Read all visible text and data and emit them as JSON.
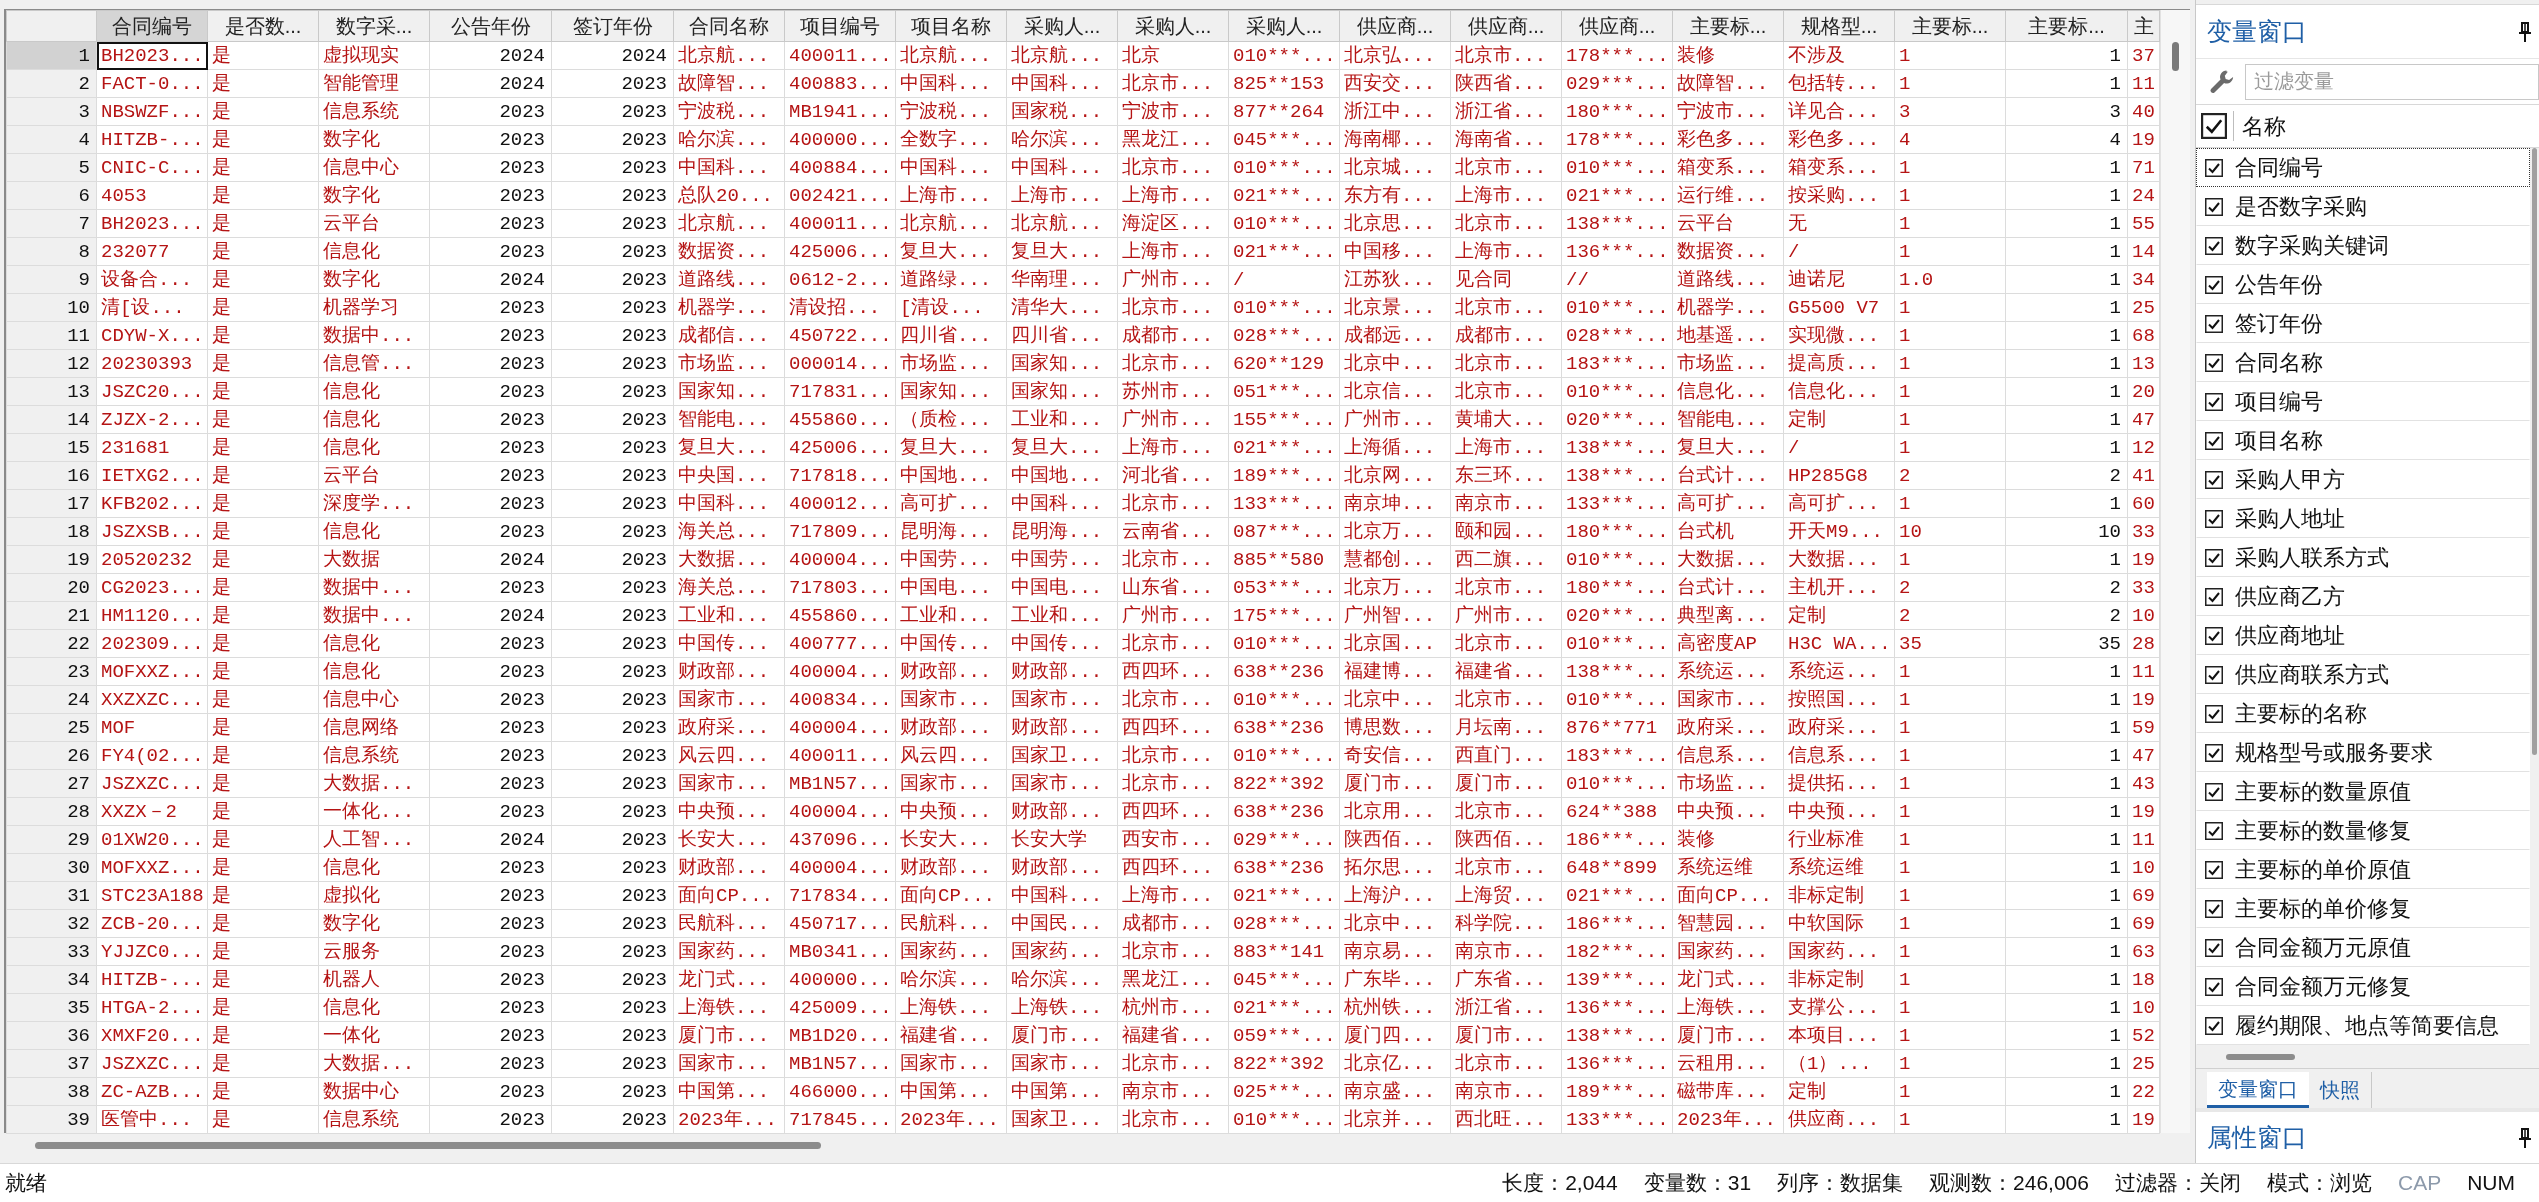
{
  "data_table": {
    "columns": [
      {
        "label": "合同编号",
        "kind": "string",
        "selected": true
      },
      {
        "label": "是否数...",
        "kind": "string",
        "selected": false
      },
      {
        "label": "数字采...",
        "kind": "string",
        "selected": false
      },
      {
        "label": "公告年份",
        "kind": "numeric",
        "selected": false
      },
      {
        "label": "签订年份",
        "kind": "numeric",
        "selected": false
      },
      {
        "label": "合同名称",
        "kind": "string",
        "selected": false
      },
      {
        "label": "项目编号",
        "kind": "string",
        "selected": false
      },
      {
        "label": "项目名称",
        "kind": "string",
        "selected": false
      },
      {
        "label": "采购人...",
        "kind": "string",
        "selected": false
      },
      {
        "label": "采购人...",
        "kind": "string",
        "selected": false
      },
      {
        "label": "采购人...",
        "kind": "string",
        "selected": false
      },
      {
        "label": "供应商...",
        "kind": "string",
        "selected": false
      },
      {
        "label": "供应商...",
        "kind": "string",
        "selected": false
      },
      {
        "label": "供应商...",
        "kind": "string",
        "selected": false
      },
      {
        "label": "主要标...",
        "kind": "string",
        "selected": false
      },
      {
        "label": "规格型...",
        "kind": "string",
        "selected": false
      },
      {
        "label": "主要标...",
        "kind": "string",
        "selected": false
      },
      {
        "label": "主要标...",
        "kind": "numeric",
        "selected": false
      },
      {
        "label": "主",
        "kind": "string",
        "selected": false
      }
    ],
    "rows": [
      {
        "number": "1",
        "selected": true,
        "cells": [
          "BH2023...",
          "是",
          "虚拟现实",
          "2024",
          "2024",
          "北京航...",
          "400011...",
          "北京航...",
          "北京航...",
          "北京",
          "010***...",
          "北京弘...",
          "北京市...",
          "178***...",
          "装修",
          "不涉及",
          "1",
          "1",
          "37"
        ]
      },
      {
        "number": "2",
        "selected": false,
        "cells": [
          "FACT-0...",
          "是",
          "智能管理",
          "2024",
          "2023",
          "故障智...",
          "400883...",
          "中国科...",
          "中国科...",
          "北京市...",
          "825**153",
          "西安交...",
          "陕西省...",
          "029***...",
          "故障智...",
          "包括转...",
          "1",
          "1",
          "11"
        ]
      },
      {
        "number": "3",
        "selected": false,
        "cells": [
          "NBSWZF...",
          "是",
          "信息系统",
          "2023",
          "2023",
          "宁波税...",
          "MB1941...",
          "宁波税...",
          "国家税...",
          "宁波市...",
          "877**264",
          "浙江中...",
          "浙江省...",
          "180***...",
          "宁波市...",
          "详见合...",
          "3",
          "3",
          "40"
        ]
      },
      {
        "number": "4",
        "selected": false,
        "cells": [
          "HITZB-...",
          "是",
          "数字化",
          "2023",
          "2023",
          "哈尔滨...",
          "400000...",
          "全数字...",
          "哈尔滨...",
          "黑龙江...",
          "045***...",
          "海南椰...",
          "海南省...",
          "178***...",
          "彩色多...",
          "彩色多...",
          "4",
          "4",
          "19"
        ]
      },
      {
        "number": "5",
        "selected": false,
        "cells": [
          "CNIC-C...",
          "是",
          "信息中心",
          "2023",
          "2023",
          "中国科...",
          "400884...",
          "中国科...",
          "中国科...",
          "北京市...",
          "010***...",
          "北京城...",
          "北京市...",
          "010***...",
          "箱变系...",
          "箱变系...",
          "1",
          "1",
          "71"
        ]
      },
      {
        "number": "6",
        "selected": false,
        "cells": [
          "4053",
          "是",
          "数字化",
          "2023",
          "2023",
          "总队20...",
          "002421...",
          "上海市...",
          "上海市...",
          "上海市...",
          "021***...",
          "东方有...",
          "上海市...",
          "021***...",
          "运行维...",
          "按采购...",
          "1",
          "1",
          "24"
        ]
      },
      {
        "number": "7",
        "selected": false,
        "cells": [
          "BH2023...",
          "是",
          "云平台",
          "2023",
          "2023",
          "北京航...",
          "400011...",
          "北京航...",
          "北京航...",
          "海淀区...",
          "010***...",
          "北京思...",
          "北京市...",
          "138***...",
          "云平台",
          "无",
          "1",
          "1",
          "55"
        ]
      },
      {
        "number": "8",
        "selected": false,
        "cells": [
          "232077",
          "是",
          "信息化",
          "2023",
          "2023",
          "数据资...",
          "425006...",
          "复旦大...",
          "复旦大...",
          "上海市...",
          "021***...",
          "中国移...",
          "上海市...",
          "136***...",
          "数据资...",
          "/",
          "1",
          "1",
          "14"
        ]
      },
      {
        "number": "9",
        "selected": false,
        "cells": [
          "设备合...",
          "是",
          "数字化",
          "2024",
          "2023",
          "道路线...",
          "0612-2...",
          "道路绿...",
          "华南理...",
          "广州市...",
          "/",
          "江苏狄...",
          "见合同",
          "//",
          "道路线...",
          "迪诺尼",
          "1.0",
          "1",
          "34"
        ]
      },
      {
        "number": "10",
        "selected": false,
        "cells": [
          "清[设...",
          "是",
          "机器学习",
          "2023",
          "2023",
          "机器学...",
          "清设招...",
          "[清设...",
          "清华大...",
          "北京市...",
          "010***...",
          "北京景...",
          "北京市...",
          "010***...",
          "机器学...",
          "G5500 V7",
          "1",
          "1",
          "25"
        ]
      },
      {
        "number": "11",
        "selected": false,
        "cells": [
          "CDYW-X...",
          "是",
          "数据中...",
          "2023",
          "2023",
          "成都信...",
          "450722...",
          "四川省...",
          "四川省...",
          "成都市...",
          "028***...",
          "成都远...",
          "成都市...",
          "028***...",
          "地基遥...",
          "实现微...",
          "1",
          "1",
          "68"
        ]
      },
      {
        "number": "12",
        "selected": false,
        "cells": [
          "20230393",
          "是",
          "信息管...",
          "2023",
          "2023",
          "市场监...",
          "000014...",
          "市场监...",
          "国家知...",
          "北京市...",
          "620**129",
          "北京中...",
          "北京市...",
          "183***...",
          "市场监...",
          "提高质...",
          "1",
          "1",
          "13"
        ]
      },
      {
        "number": "13",
        "selected": false,
        "cells": [
          "JSZC20...",
          "是",
          "信息化",
          "2023",
          "2023",
          "国家知...",
          "717831...",
          "国家知...",
          "国家知...",
          "苏州市...",
          "051***...",
          "北京信...",
          "北京市...",
          "010***...",
          "信息化...",
          "信息化...",
          "1",
          "1",
          "20"
        ]
      },
      {
        "number": "14",
        "selected": false,
        "cells": [
          "ZJZX-2...",
          "是",
          "信息化",
          "2023",
          "2023",
          "智能电...",
          "455860...",
          "（质检...",
          "工业和...",
          "广州市...",
          "155***...",
          "广州市...",
          "黄埔大...",
          "020***...",
          "智能电...",
          "定制",
          "1",
          "1",
          "47"
        ]
      },
      {
        "number": "15",
        "selected": false,
        "cells": [
          "231681",
          "是",
          "信息化",
          "2023",
          "2023",
          "复旦大...",
          "425006...",
          "复旦大...",
          "复旦大...",
          "上海市...",
          "021***...",
          "上海循...",
          "上海市...",
          "138***...",
          "复旦大...",
          "/",
          "1",
          "1",
          "12"
        ]
      },
      {
        "number": "16",
        "selected": false,
        "cells": [
          "IETXG2...",
          "是",
          "云平台",
          "2023",
          "2023",
          "中央国...",
          "717818...",
          "中国地...",
          "中国地...",
          "河北省...",
          "189***...",
          "北京网...",
          "东三环...",
          "138***...",
          "台式计...",
          "HP285G8",
          "2",
          "2",
          "41"
        ]
      },
      {
        "number": "17",
        "selected": false,
        "cells": [
          "KFB202...",
          "是",
          "深度学...",
          "2023",
          "2023",
          "中国科...",
          "400012...",
          "高可扩...",
          "中国科...",
          "北京市...",
          "133***...",
          "南京坤...",
          "南京市...",
          "133***...",
          "高可扩...",
          "高可扩...",
          "1",
          "1",
          "60"
        ]
      },
      {
        "number": "18",
        "selected": false,
        "cells": [
          "JSZXSB...",
          "是",
          "信息化",
          "2023",
          "2023",
          "海关总...",
          "717809...",
          "昆明海...",
          "昆明海...",
          "云南省...",
          "087***...",
          "北京万...",
          "颐和园...",
          "180***...",
          "台式机",
          "开天M9...",
          "10",
          "10",
          "33"
        ]
      },
      {
        "number": "19",
        "selected": false,
        "cells": [
          "20520232",
          "是",
          "大数据",
          "2024",
          "2023",
          "大数据...",
          "400004...",
          "中国劳...",
          "中国劳...",
          "北京市...",
          "885**580",
          "慧都创...",
          "西二旗...",
          "010***...",
          "大数据...",
          "大数据...",
          "1",
          "1",
          "19"
        ]
      },
      {
        "number": "20",
        "selected": false,
        "cells": [
          "CG2023...",
          "是",
          "数据中...",
          "2023",
          "2023",
          "海关总...",
          "717803...",
          "中国电...",
          "中国电...",
          "山东省...",
          "053***...",
          "北京万...",
          "北京市...",
          "180***...",
          "台式计...",
          "主机开...",
          "2",
          "2",
          "33"
        ]
      },
      {
        "number": "21",
        "selected": false,
        "cells": [
          "HM1120...",
          "是",
          "数据中...",
          "2024",
          "2023",
          "工业和...",
          "455860...",
          "工业和...",
          "工业和...",
          "广州市...",
          "175***...",
          "广州智...",
          "广州市...",
          "020***...",
          "典型离...",
          "定制",
          "2",
          "2",
          "10"
        ]
      },
      {
        "number": "22",
        "selected": false,
        "cells": [
          "202309...",
          "是",
          "信息化",
          "2023",
          "2023",
          "中国传...",
          "400777...",
          "中国传...",
          "中国传...",
          "北京市...",
          "010***...",
          "北京国...",
          "北京市...",
          "010***...",
          "高密度AP",
          "H3C WA...",
          "35",
          "35",
          "28"
        ]
      },
      {
        "number": "23",
        "selected": false,
        "cells": [
          "MOFXXZ...",
          "是",
          "信息化",
          "2023",
          "2023",
          "财政部...",
          "400004...",
          "财政部...",
          "财政部...",
          "西四环...",
          "638**236",
          "福建博...",
          "福建省...",
          "138***...",
          "系统运...",
          "系统运...",
          "1",
          "1",
          "11"
        ]
      },
      {
        "number": "24",
        "selected": false,
        "cells": [
          "XXZXZC...",
          "是",
          "信息中心",
          "2023",
          "2023",
          "国家市...",
          "400834...",
          "国家市...",
          "国家市...",
          "北京市...",
          "010***...",
          "北京中...",
          "北京市...",
          "010***...",
          "国家市...",
          "按照国...",
          "1",
          "1",
          "19"
        ]
      },
      {
        "number": "25",
        "selected": false,
        "cells": [
          "MOF",
          "是",
          "信息网络",
          "2023",
          "2023",
          "政府采...",
          "400004...",
          "财政部...",
          "财政部...",
          "西四环...",
          "638**236",
          "博思数...",
          "月坛南...",
          "876**771",
          "政府采...",
          "政府采...",
          "1",
          "1",
          "59"
        ]
      },
      {
        "number": "26",
        "selected": false,
        "cells": [
          "FY4(02...",
          "是",
          "信息系统",
          "2023",
          "2023",
          "风云四...",
          "400011...",
          "风云四...",
          "国家卫...",
          "北京市...",
          "010***...",
          "奇安信...",
          "西直门...",
          "183***...",
          "信息系...",
          "信息系...",
          "1",
          "1",
          "47"
        ]
      },
      {
        "number": "27",
        "selected": false,
        "cells": [
          "JSZXZC...",
          "是",
          "大数据...",
          "2023",
          "2023",
          "国家市...",
          "MB1N57...",
          "国家市...",
          "国家市...",
          "北京市...",
          "822**392",
          "厦门市...",
          "厦门市...",
          "010***...",
          "市场监...",
          "提供拓...",
          "1",
          "1",
          "43"
        ]
      },
      {
        "number": "28",
        "selected": false,
        "cells": [
          "XXZX－2",
          "是",
          "一体化...",
          "2023",
          "2023",
          "中央预...",
          "400004...",
          "中央预...",
          "财政部...",
          "西四环...",
          "638**236",
          "北京用...",
          "北京市...",
          "624**388",
          "中央预...",
          "中央预...",
          "1",
          "1",
          "19"
        ]
      },
      {
        "number": "29",
        "selected": false,
        "cells": [
          "01XW20...",
          "是",
          "人工智...",
          "2024",
          "2023",
          "长安大...",
          "437096...",
          "长安大...",
          "长安大学",
          "西安市...",
          "029***...",
          "陕西佰...",
          "陕西佰...",
          "186***...",
          "装修",
          "行业标准",
          "1",
          "1",
          "11"
        ]
      },
      {
        "number": "30",
        "selected": false,
        "cells": [
          "MOFXXZ...",
          "是",
          "信息化",
          "2023",
          "2023",
          "财政部...",
          "400004...",
          "财政部...",
          "财政部...",
          "西四环...",
          "638**236",
          "拓尔思...",
          "北京市...",
          "648**899",
          "系统运维",
          "系统运维",
          "1",
          "1",
          "10"
        ]
      },
      {
        "number": "31",
        "selected": false,
        "cells": [
          "STC23A188",
          "是",
          "虚拟化",
          "2023",
          "2023",
          "面向CP...",
          "717834...",
          "面向CP...",
          "中国科...",
          "上海市...",
          "021***...",
          "上海沪...",
          "上海贸...",
          "021***...",
          "面向CP...",
          "非标定制",
          "1",
          "1",
          "69"
        ]
      },
      {
        "number": "32",
        "selected": false,
        "cells": [
          "ZCB-20...",
          "是",
          "数字化",
          "2023",
          "2023",
          "民航科...",
          "450717...",
          "民航科...",
          "中国民...",
          "成都市...",
          "028***...",
          "北京中...",
          "科学院...",
          "186***...",
          "智慧园...",
          "中软国际",
          "1",
          "1",
          "69"
        ]
      },
      {
        "number": "33",
        "selected": false,
        "cells": [
          "YJJZC0...",
          "是",
          "云服务",
          "2023",
          "2023",
          "国家药...",
          "MB0341...",
          "国家药...",
          "国家药...",
          "北京市...",
          "883**141",
          "南京易...",
          "南京市...",
          "182***...",
          "国家药...",
          "国家药...",
          "1",
          "1",
          "63"
        ]
      },
      {
        "number": "34",
        "selected": false,
        "cells": [
          "HITZB-...",
          "是",
          "机器人",
          "2023",
          "2023",
          "龙门式...",
          "400000...",
          "哈尔滨...",
          "哈尔滨...",
          "黑龙江...",
          "045***...",
          "广东毕...",
          "广东省...",
          "139***...",
          "龙门式...",
          "非标定制",
          "1",
          "1",
          "18"
        ]
      },
      {
        "number": "35",
        "selected": false,
        "cells": [
          "HTGA-2...",
          "是",
          "信息化",
          "2023",
          "2023",
          "上海铁...",
          "425009...",
          "上海铁...",
          "上海铁...",
          "杭州市...",
          "021***...",
          "杭州铁...",
          "浙江省...",
          "136***...",
          "上海铁...",
          "支撑公...",
          "1",
          "1",
          "10"
        ]
      },
      {
        "number": "36",
        "selected": false,
        "cells": [
          "XMXF20...",
          "是",
          "一体化",
          "2023",
          "2023",
          "厦门市...",
          "MB1D20...",
          "福建省...",
          "厦门市...",
          "福建省...",
          "059***...",
          "厦门四...",
          "厦门市...",
          "138***...",
          "厦门市...",
          "本项目...",
          "1",
          "1",
          "52"
        ]
      },
      {
        "number": "37",
        "selected": false,
        "cells": [
          "JSZXZC...",
          "是",
          "大数据...",
          "2023",
          "2023",
          "国家市...",
          "MB1N57...",
          "国家市...",
          "国家市...",
          "北京市...",
          "822**392",
          "北京亿...",
          "北京市...",
          "136***...",
          "云租用...",
          "（1）...",
          "1",
          "1",
          "25"
        ]
      },
      {
        "number": "38",
        "selected": false,
        "cells": [
          "ZC-AZB...",
          "是",
          "数据中心",
          "2023",
          "2023",
          "中国第...",
          "466000...",
          "中国第...",
          "中国第...",
          "南京市...",
          "025***...",
          "南京盛...",
          "南京市...",
          "189***...",
          "磁带库...",
          "定制",
          "1",
          "1",
          "22"
        ]
      },
      {
        "number": "39",
        "selected": false,
        "cells": [
          "医管中...",
          "是",
          "信息系统",
          "2023",
          "2023",
          "2023年...",
          "717845...",
          "2023年...",
          "国家卫...",
          "北京市...",
          "010***...",
          "北京并...",
          "西北旺...",
          "133***...",
          "2023年...",
          "供应商...",
          "1",
          "1",
          "19"
        ]
      }
    ]
  },
  "variables_window": {
    "title": "变量窗口",
    "filter": {
      "placeholder": "过滤变量"
    },
    "header": {
      "label": "名称",
      "checked": true
    },
    "items": [
      {
        "name": "合同编号",
        "checked": true,
        "selected": true
      },
      {
        "name": "是否数字采购",
        "checked": true,
        "selected": false
      },
      {
        "name": "数字采购关键词",
        "checked": true,
        "selected": false
      },
      {
        "name": "公告年份",
        "checked": true,
        "selected": false
      },
      {
        "name": "签订年份",
        "checked": true,
        "selected": false
      },
      {
        "name": "合同名称",
        "checked": true,
        "selected": false
      },
      {
        "name": "项目编号",
        "checked": true,
        "selected": false
      },
      {
        "name": "项目名称",
        "checked": true,
        "selected": false
      },
      {
        "name": "采购人甲方",
        "checked": true,
        "selected": false
      },
      {
        "name": "采购人地址",
        "checked": true,
        "selected": false
      },
      {
        "name": "采购人联系方式",
        "checked": true,
        "selected": false
      },
      {
        "name": "供应商乙方",
        "checked": true,
        "selected": false
      },
      {
        "name": "供应商地址",
        "checked": true,
        "selected": false
      },
      {
        "name": "供应商联系方式",
        "checked": true,
        "selected": false
      },
      {
        "name": "主要标的名称",
        "checked": true,
        "selected": false
      },
      {
        "name": "规格型号或服务要求",
        "checked": true,
        "selected": false
      },
      {
        "name": "主要标的数量原值",
        "checked": true,
        "selected": false
      },
      {
        "name": "主要标的数量修复",
        "checked": true,
        "selected": false
      },
      {
        "name": "主要标的单价原值",
        "checked": true,
        "selected": false
      },
      {
        "name": "主要标的单价修复",
        "checked": true,
        "selected": false
      },
      {
        "name": "合同金额万元原值",
        "checked": true,
        "selected": false
      },
      {
        "name": "合同金额万元修复",
        "checked": true,
        "selected": false
      },
      {
        "name": "履约期限、地点等简要信息",
        "checked": true,
        "selected": false
      }
    ],
    "tabs": [
      {
        "label": "变量窗口",
        "selected": true
      },
      {
        "label": "快照",
        "selected": false
      }
    ]
  },
  "properties_window": {
    "title": "属性窗口"
  },
  "status_bar": {
    "message": "就绪",
    "fields": [
      "长度：2,044",
      "变量数：31",
      "列序：数据集",
      "观测数：246,006",
      "过滤器：关闭",
      "模式：浏览"
    ],
    "indicators": [
      {
        "label": "CAP",
        "on": false
      },
      {
        "label": "NUM",
        "on": true
      }
    ]
  }
}
